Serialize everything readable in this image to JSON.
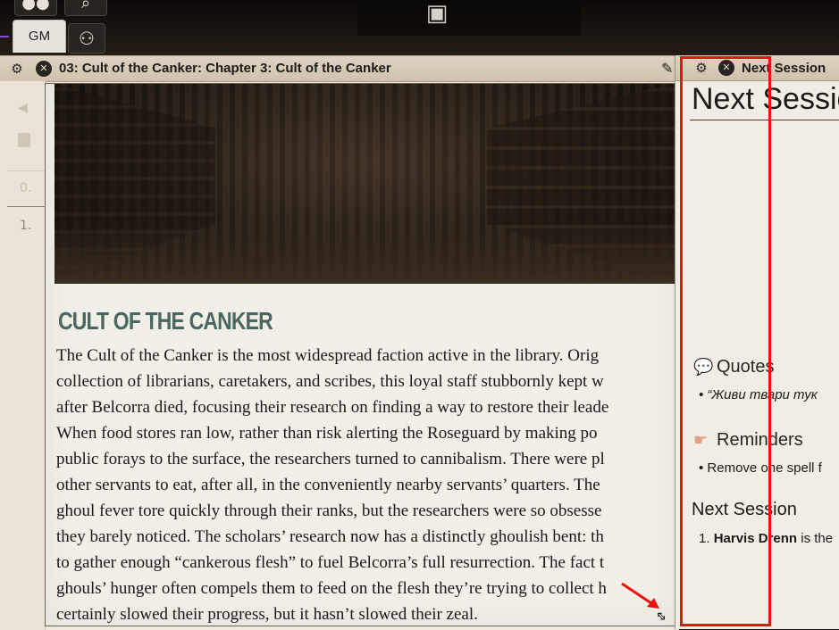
{
  "toolbar": {
    "gm_tab_label": "GM"
  },
  "journal": {
    "title": "03: Cult of the Canker: Chapter 3: Cult of the Canker",
    "sidebar_items": [
      "0.",
      "1."
    ],
    "heading": "CULT OF THE CANKER",
    "body_lines": [
      "The Cult of the Canker is the most widespread faction active in the library. Orig",
      "collection of librarians, caretakers, and scribes, this loyal staff stubbornly kept w",
      "after Belcorra died, focusing their research on finding a way to restore their leade",
      "When food stores ran low, rather than risk alerting the Roseguard by making po",
      "public forays to the surface, the researchers turned to cannibalism. There were pl",
      "other servants to eat, after all, in the conveniently nearby servants’ quarters. The",
      "ghoul fever tore quickly through their ranks, but the researchers were so obsesse",
      "they barely noticed. The scholars’ research now has a distinctly ghoulish bent: th",
      "to gather enough “cankerous flesh” to fuel Belcorra’s full resurrection. The fact t",
      "ghouls’ hunger often compels them to feed on the flesh they’re trying to collect h",
      "certainly slowed their progress, but it hasn’t slowed their zeal."
    ]
  },
  "notes": {
    "header_title": "Next Session",
    "big_title": "Next Sessio",
    "quotes_heading": "Quotes",
    "quotes_item": "“Живи твари тук",
    "reminders_heading": "Reminders",
    "reminders_item": "Remove one spell f",
    "next_heading": "Next Session",
    "next_item_number": "1.",
    "next_item_bold": "Harvis Drenn",
    "next_item_rest": " is the"
  },
  "colors": {
    "heading_accent": "#4a6860",
    "highlight_box": "#e8120f"
  }
}
